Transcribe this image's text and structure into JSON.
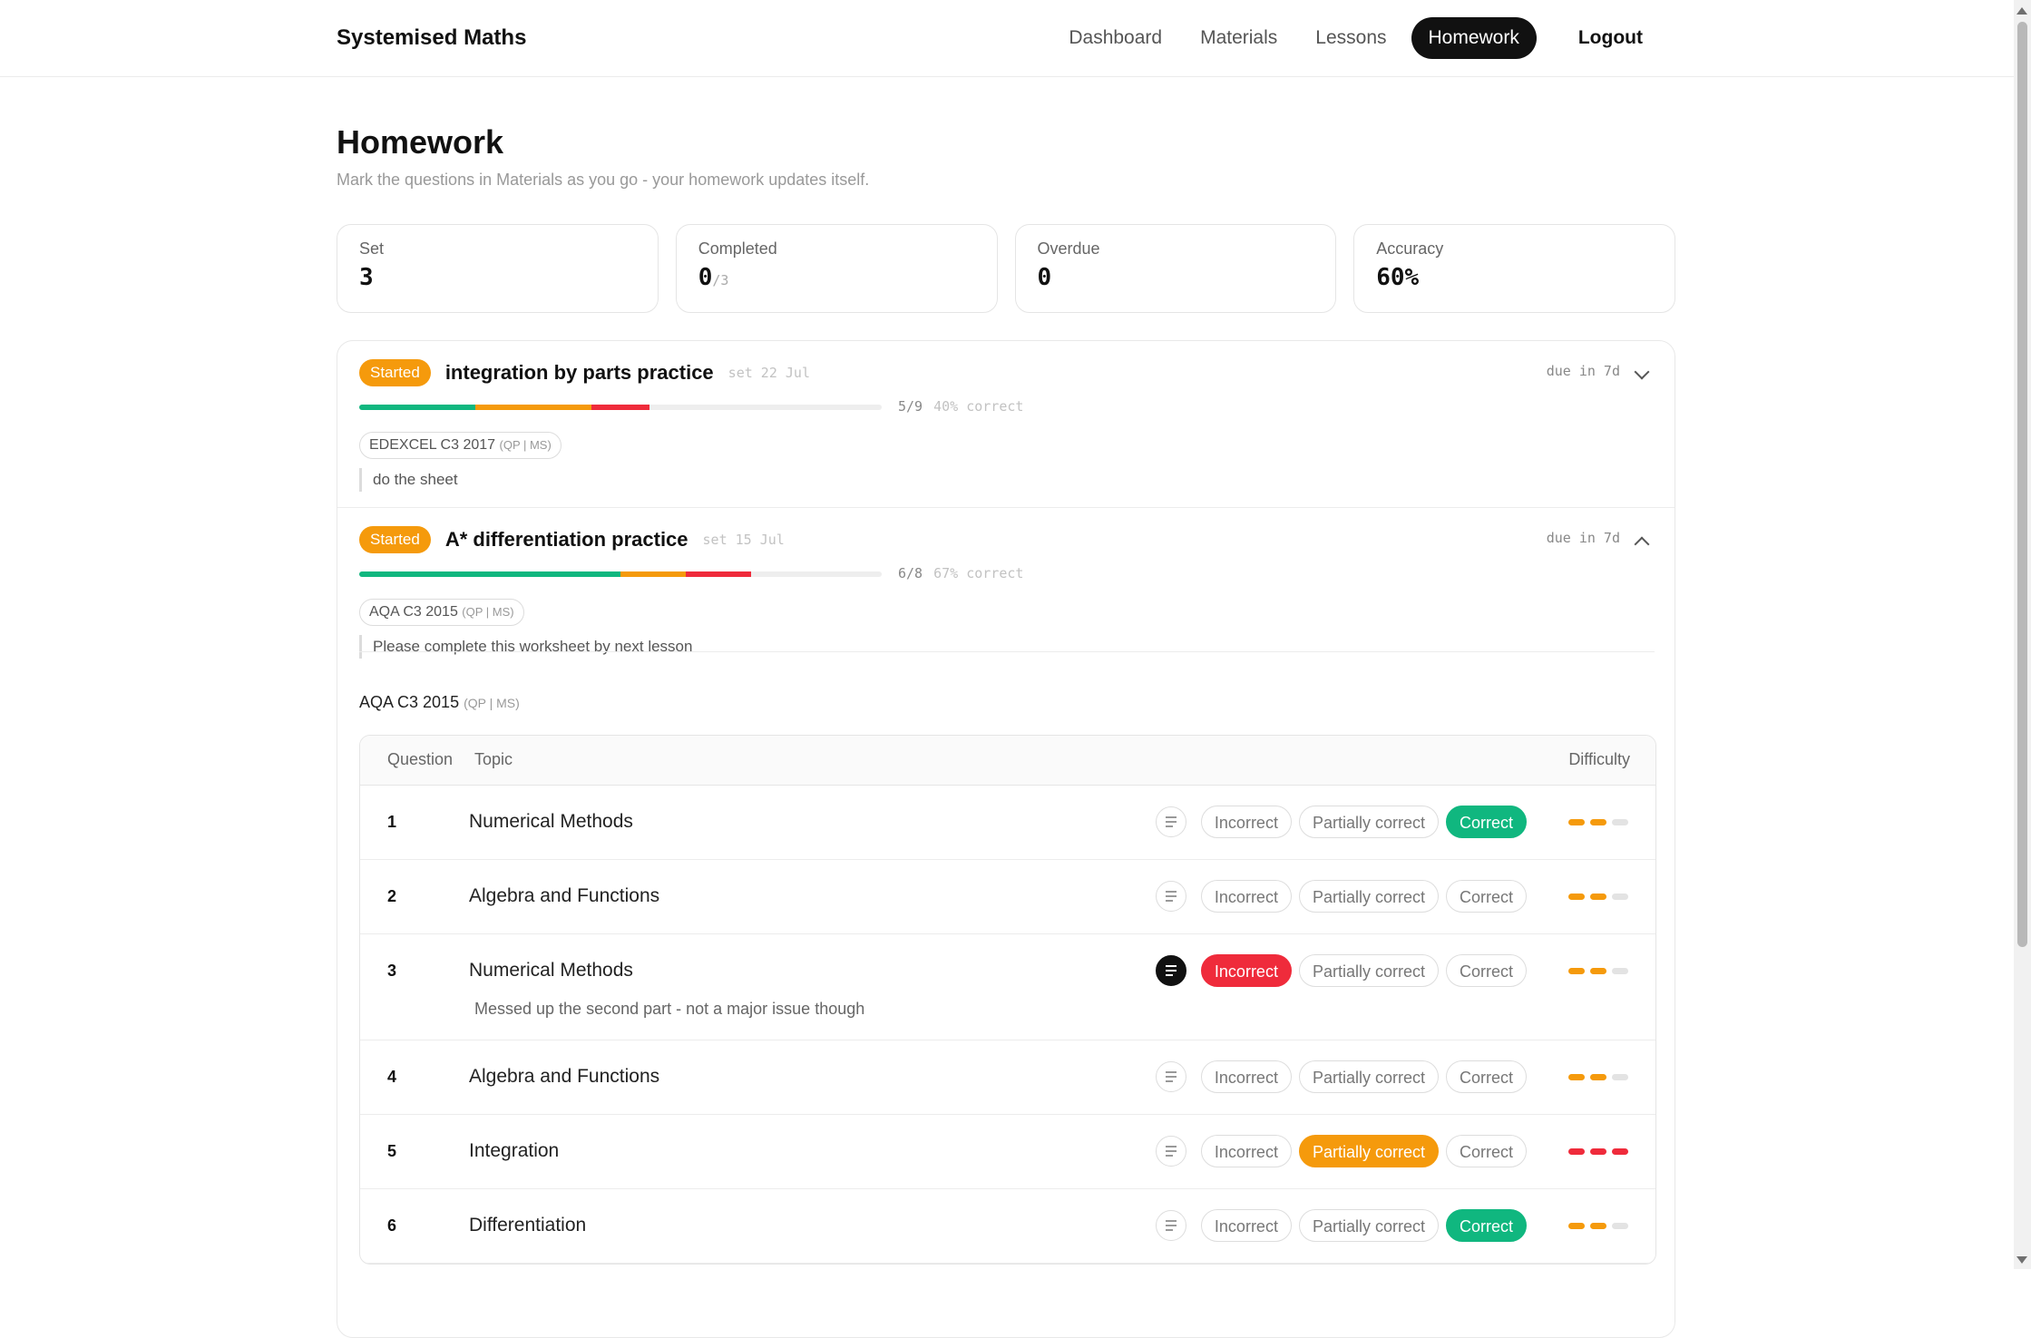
{
  "nav": {
    "brand": "Systemised Maths",
    "links": [
      "Dashboard",
      "Materials",
      "Lessons",
      "Homework"
    ],
    "logout": "Logout"
  },
  "header": {
    "title": "Homework",
    "subtitle": "Mark the questions in Materials as you go - your homework updates itself."
  },
  "stats": {
    "set": {
      "label": "Set",
      "value": "3"
    },
    "completed": {
      "label": "Completed",
      "value": "0",
      "of": "/3"
    },
    "overdue": {
      "label": "Overdue",
      "value": "0"
    },
    "accuracy": {
      "label": "Accuracy",
      "value": "60%"
    }
  },
  "homeworks": [
    {
      "status": "Started",
      "title": "integration by parts practice",
      "set": "set 22 Jul",
      "due": "due in 7d",
      "progress": {
        "correct": 2,
        "partial": 2,
        "incorrect": 1,
        "total": 9
      },
      "progress_text": "5/9",
      "accuracy_text": "40% correct",
      "paper": "EDEXCEL C3 2017",
      "paper_sub": "(QP | MS)",
      "note": "do the sheet"
    },
    {
      "status": "Started",
      "title": "A* differentiation practice",
      "set": "set 15 Jul",
      "due": "due in 7d",
      "progress": {
        "correct": 4,
        "partial": 1,
        "incorrect": 1,
        "total": 8
      },
      "progress_text": "6/8",
      "accuracy_text": "67% correct",
      "paper": "AQA C3 2015",
      "paper_sub": "(QP | MS)",
      "note": "Please complete this worksheet by next lesson",
      "section": {
        "label": "AQA C3 2015",
        "sub": "(QP | MS)"
      }
    }
  ],
  "table": {
    "headers": {
      "question": "Question",
      "topic": "Topic",
      "difficulty": "Difficulty"
    },
    "options": {
      "incorrect": "Incorrect",
      "partial": "Partially correct",
      "correct": "Correct"
    },
    "rows": [
      {
        "num": "1",
        "topic": "Numerical Methods",
        "mark": "correct",
        "difficulty": 2,
        "has_note": false
      },
      {
        "num": "2",
        "topic": "Algebra and Functions",
        "mark": "none",
        "difficulty": 2,
        "has_note": false
      },
      {
        "num": "3",
        "topic": "Numerical Methods",
        "mark": "incorrect",
        "difficulty": 2,
        "has_note": true,
        "note": "Messed up the second part - not a major issue though"
      },
      {
        "num": "4",
        "topic": "Algebra and Functions",
        "mark": "none",
        "difficulty": 2,
        "has_note": false
      },
      {
        "num": "5",
        "topic": "Integration",
        "mark": "partial",
        "difficulty": 3,
        "has_note": false
      },
      {
        "num": "6",
        "topic": "Differentiation",
        "mark": "correct",
        "difficulty": 2,
        "has_note": false
      }
    ]
  },
  "colors": {
    "correct": "#10b77f",
    "partial": "#f59a0c",
    "incorrect": "#ef2b3b",
    "nav_active": "#111111"
  }
}
